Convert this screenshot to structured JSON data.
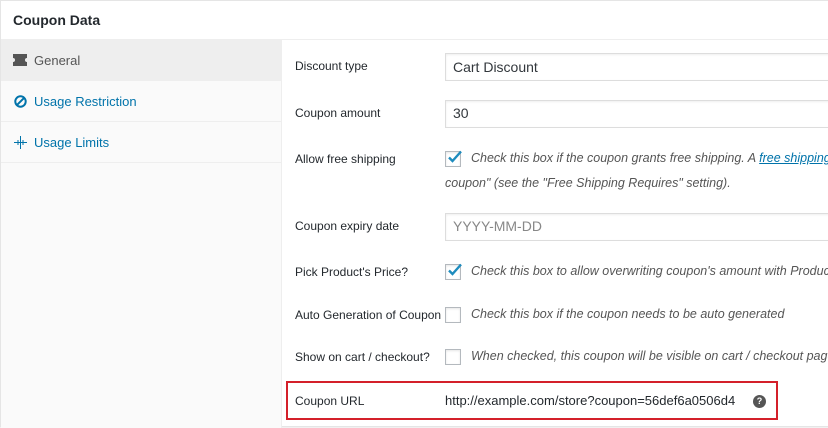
{
  "panel": {
    "title": "Coupon Data"
  },
  "sidebar": {
    "items": [
      {
        "label": "General",
        "icon": "ticket-icon",
        "active": true
      },
      {
        "label": "Usage Restriction",
        "icon": "prohibited-icon",
        "active": false
      },
      {
        "label": "Usage Limits",
        "icon": "crosshair-icon",
        "active": false
      }
    ]
  },
  "fields": {
    "discount_type": {
      "label": "Discount type",
      "value": "Cart Discount"
    },
    "coupon_amount": {
      "label": "Coupon amount",
      "value": "30"
    },
    "free_shipping": {
      "label": "Allow free shipping",
      "checked": true,
      "desc_pre": "Check this box if the coupon grants free shipping. A ",
      "desc_link": "free shipping",
      "desc_line2": "coupon\" (see the \"Free Shipping Requires\" setting)."
    },
    "expiry_date": {
      "label": "Coupon expiry date",
      "placeholder": "YYYY-MM-DD"
    },
    "pick_price": {
      "label": "Pick Product's Price?",
      "checked": true,
      "desc": "Check this box to allow overwriting coupon's amount with Product"
    },
    "auto_generation": {
      "label": "Auto Generation of Coupon",
      "checked": false,
      "desc": "Check this box if the coupon needs to be auto generated"
    },
    "show_on_cart": {
      "label": "Show on cart / checkout?",
      "checked": false,
      "desc": "When checked, this coupon will be visible on cart / checkout page"
    },
    "coupon_url": {
      "label": "Coupon URL",
      "value": "http://example.com/store?coupon=56def6a0506d4",
      "help": "?"
    }
  },
  "colors": {
    "highlight": "#d4202a",
    "link": "#0073aa",
    "check": "#1e8cbe"
  }
}
